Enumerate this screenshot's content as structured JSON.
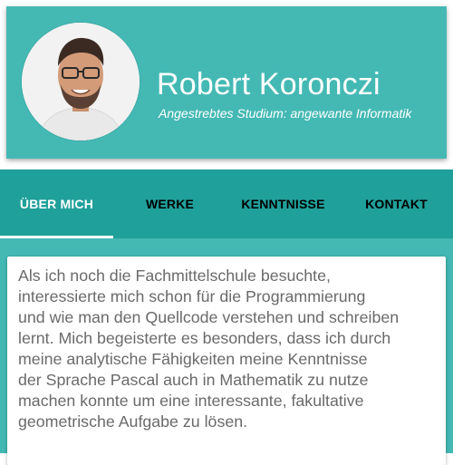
{
  "profile": {
    "name": "Robert Koronczi",
    "subtitle": "Angestrebtes Studium: angewante Informatik",
    "avatar_icon": "profile-photo"
  },
  "tabs": [
    {
      "label": "ÜBER MICH",
      "active": true
    },
    {
      "label": "WERKE",
      "active": false
    },
    {
      "label": "KENNTNISSE",
      "active": false
    },
    {
      "label": "KONTAKT",
      "active": false
    }
  ],
  "about": {
    "text": "Als ich noch die Fachmittelschule besuchte,\ninteressierte mich schon für die Programmierung\nund wie man den Quellcode verstehen und schreiben\nlernt. Mich begeisterte es besonders, dass ich durch\nmeine analytische Fähigkeiten meine Kenntnisse\nder Sprache Pascal auch in Mathematik zu nutze\nmachen konnte um eine interessante, fakultative\ngeometrische Aufgabe zu lösen."
  },
  "colors": {
    "header": "#44b9b4",
    "tabbar": "#1fa09b",
    "active_tab_text": "#ffffff",
    "inactive_tab_text": "#000000",
    "body_text": "#6a6a6a"
  }
}
